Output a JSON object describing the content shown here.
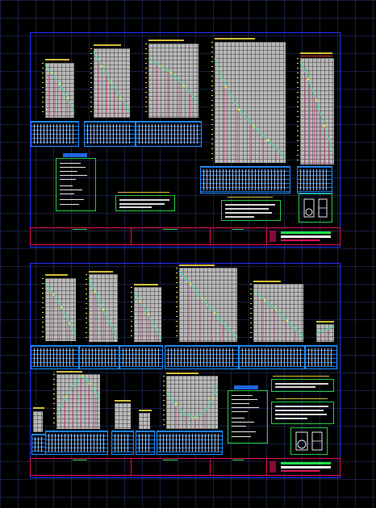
{
  "title_blocks": [
    {
      "cells": [
        "",
        "",
        "",
        ""
      ]
    },
    {
      "cells": [
        "",
        "",
        "",
        ""
      ]
    }
  ],
  "icons": [
    "cad-grid",
    "sewer-profile",
    "manhole-detail",
    "title-block"
  ],
  "colors": {
    "background": "#000000",
    "frame": "#2233ff",
    "title_block": "#e0105a",
    "profile_bg": "#b9b9b9",
    "invert": "#35e0a0",
    "ground": "#e8d23a",
    "table": "#1e90ff",
    "note_frame": "#22cc44"
  }
}
